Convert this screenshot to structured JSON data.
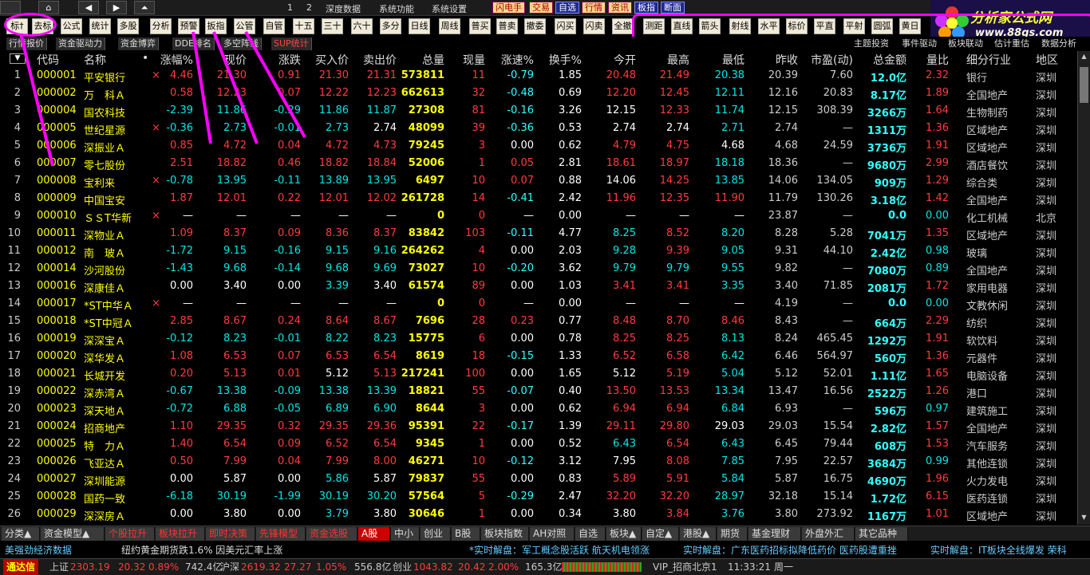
{
  "topbar": {
    "nums": [
      "1",
      "2"
    ],
    "menus": [
      "深度数据",
      "系统功能",
      "系统设置"
    ],
    "buttons": [
      "闪电手",
      "交易",
      "自选",
      "行情",
      "资讯",
      "板指",
      "断面"
    ]
  },
  "logo": {
    "title": "分析家公式网",
    "url": "www.88gs.com"
  },
  "toolbar": {
    "items": [
      "标†",
      "去标",
      "公式",
      "统计",
      "多股",
      "分析",
      "预警",
      "扳指",
      "公管",
      "自管",
      "十五",
      "三十",
      "六十",
      "多分",
      "日线",
      "周线",
      "普买",
      "普卖",
      "撤委",
      "闪买",
      "闪卖",
      "全撤",
      "测距",
      "直线",
      "箭头",
      "射线",
      "水平",
      "标价",
      "平直",
      "平射",
      "圆弧",
      "黄日"
    ]
  },
  "tabs2": {
    "left": [
      "行情报价",
      "资金驱动力",
      "资金博弈",
      "DDE排名",
      "多空阵线",
      "SUP统计"
    ],
    "right": [
      "主题投资",
      "事件驱动",
      "板块联动",
      "估计重估",
      "数据分析"
    ]
  },
  "columns": [
    "代码",
    "名称",
    "•",
    "涨幅%",
    "现价",
    "涨跌",
    "买入价",
    "卖出价",
    "总量",
    "现量",
    "涨速%",
    "换手%",
    "今开",
    "最高",
    "最低",
    "昨收",
    "市盈(动)",
    "总金额",
    "量比",
    "细分行业",
    "地区"
  ],
  "rows": [
    [
      "1",
      "000001",
      "平安银行",
      "×",
      "4.46",
      "21.30",
      "0.91",
      "21.30",
      "21.31",
      "573811",
      "11",
      "-0.79",
      "1.85",
      "20.48",
      "21.49",
      "20.38",
      "20.39",
      "7.60",
      "12.0亿",
      "2.32",
      "银行",
      "深圳"
    ],
    [
      "2",
      "000002",
      "万　科Ａ",
      "",
      "0.58",
      "12.23",
      "0.07",
      "12.22",
      "12.23",
      "662613",
      "32",
      "-0.48",
      "0.69",
      "12.20",
      "12.45",
      "12.11",
      "12.16",
      "20.83",
      "8.17亿",
      "1.89",
      "全国地产",
      "深圳"
    ],
    [
      "3",
      "000004",
      "国农科技",
      "",
      "-2.39",
      "11.86",
      "-0.29",
      "11.86",
      "11.87",
      "27308",
      "81",
      "-0.16",
      "3.26",
      "12.15",
      "12.33",
      "11.74",
      "12.15",
      "308.39",
      "3266万",
      "1.64",
      "生物制药",
      "深圳"
    ],
    [
      "4",
      "000005",
      "世纪星源",
      "×",
      "-0.36",
      "2.73",
      "-0.01",
      "2.73",
      "2.74",
      "48099",
      "39",
      "-0.36",
      "0.53",
      "2.74",
      "2.74",
      "2.71",
      "2.74",
      "—",
      "1311万",
      "1.36",
      "区域地产",
      "深圳"
    ],
    [
      "5",
      "000006",
      "深振业Ａ",
      "",
      "0.85",
      "4.72",
      "0.04",
      "4.72",
      "4.73",
      "79245",
      "3",
      "0.00",
      "0.62",
      "4.79",
      "4.75",
      "4.68",
      "4.68",
      "24.59",
      "3736万",
      "1.91",
      "区域地产",
      "深圳"
    ],
    [
      "6",
      "000007",
      "零七股份",
      "",
      "2.51",
      "18.82",
      "0.46",
      "18.82",
      "18.84",
      "52006",
      "1",
      "0.05",
      "2.81",
      "18.61",
      "18.97",
      "18.18",
      "18.36",
      "—",
      "9680万",
      "2.99",
      "酒店餐饮",
      "深圳"
    ],
    [
      "7",
      "000008",
      "宝利来",
      "×",
      "-0.78",
      "13.95",
      "-0.11",
      "13.89",
      "13.95",
      "6497",
      "10",
      "0.07",
      "0.88",
      "14.06",
      "14.25",
      "13.85",
      "14.06",
      "134.05",
      "909万",
      "1.29",
      "综合类",
      "深圳"
    ],
    [
      "8",
      "000009",
      "中国宝安",
      "",
      "1.87",
      "12.01",
      "0.22",
      "12.01",
      "12.02",
      "261728",
      "14",
      "-0.41",
      "2.42",
      "11.96",
      "12.35",
      "11.90",
      "11.79",
      "130.26",
      "3.18亿",
      "1.42",
      "全国地产",
      "深圳"
    ],
    [
      "9",
      "000010",
      "ＳＳT华新",
      "×",
      "—",
      "—",
      "—",
      "—",
      "—",
      "0",
      "0",
      "—",
      "0.00",
      "—",
      "—",
      "—",
      "23.87",
      "—",
      "0.0",
      "0.00",
      "化工机械",
      "北京"
    ],
    [
      "10",
      "000011",
      "深物业Ａ",
      "",
      "1.09",
      "8.37",
      "0.09",
      "8.36",
      "8.37",
      "83842",
      "103",
      "-0.11",
      "4.77",
      "8.25",
      "8.52",
      "8.20",
      "8.28",
      "5.28",
      "7041万",
      "1.35",
      "区域地产",
      "深圳"
    ],
    [
      "11",
      "000012",
      "南　玻Ａ",
      "",
      "-1.72",
      "9.15",
      "-0.16",
      "9.15",
      "9.16",
      "264262",
      "4",
      "0.00",
      "2.03",
      "9.28",
      "9.39",
      "9.05",
      "9.31",
      "44.10",
      "2.42亿",
      "0.98",
      "玻璃",
      "深圳"
    ],
    [
      "12",
      "000014",
      "沙河股份",
      "",
      "-1.43",
      "9.68",
      "-0.14",
      "9.68",
      "9.69",
      "73027",
      "10",
      "-0.20",
      "3.62",
      "9.79",
      "9.79",
      "9.55",
      "9.82",
      "—",
      "7080万",
      "0.89",
      "全国地产",
      "深圳"
    ],
    [
      "13",
      "000016",
      "深康佳Ａ",
      "",
      "0.00",
      "3.40",
      "0.00",
      "3.39",
      "3.40",
      "61574",
      "89",
      "0.00",
      "1.03",
      "3.41",
      "3.41",
      "3.35",
      "3.40",
      "71.85",
      "2081万",
      "1.72",
      "家用电器",
      "深圳"
    ],
    [
      "14",
      "000017",
      "*ST中华Ａ",
      "×",
      "—",
      "—",
      "—",
      "—",
      "—",
      "0",
      "0",
      "—",
      "0.00",
      "—",
      "—",
      "—",
      "4.19",
      "—",
      "0.0",
      "0.00",
      "文教休闲",
      "深圳"
    ],
    [
      "15",
      "000018",
      "*ST中冠Ａ",
      "",
      "2.85",
      "8.67",
      "0.24",
      "8.64",
      "8.67",
      "7696",
      "28",
      "0.23",
      "0.77",
      "8.48",
      "8.70",
      "8.46",
      "8.43",
      "—",
      "664万",
      "2.29",
      "纺织",
      "深圳"
    ],
    [
      "16",
      "000019",
      "深深宝Ａ",
      "",
      "-0.12",
      "8.23",
      "-0.01",
      "8.22",
      "8.23",
      "15775",
      "6",
      "0.00",
      "0.78",
      "8.25",
      "8.25",
      "8.13",
      "8.24",
      "465.45",
      "1292万",
      "1.91",
      "软饮料",
      "深圳"
    ],
    [
      "17",
      "000020",
      "深华发Ａ",
      "",
      "1.08",
      "6.53",
      "0.07",
      "6.53",
      "6.54",
      "8619",
      "18",
      "-0.15",
      "1.33",
      "6.52",
      "6.58",
      "6.42",
      "6.46",
      "564.97",
      "560万",
      "1.36",
      "元器件",
      "深圳"
    ],
    [
      "18",
      "000021",
      "长城开发",
      "",
      "0.20",
      "5.13",
      "0.01",
      "5.12",
      "5.13",
      "217241",
      "100",
      "0.00",
      "1.65",
      "5.12",
      "5.19",
      "5.04",
      "5.12",
      "52.01",
      "1.11亿",
      "1.65",
      "电脑设备",
      "深圳"
    ],
    [
      "19",
      "000022",
      "深赤湾Ａ",
      "",
      "-0.67",
      "13.38",
      "-0.09",
      "13.38",
      "13.39",
      "18821",
      "55",
      "-0.07",
      "0.40",
      "13.50",
      "13.53",
      "13.34",
      "13.47",
      "16.56",
      "2522万",
      "1.26",
      "港口",
      "深圳"
    ],
    [
      "20",
      "000023",
      "深天地Ａ",
      "",
      "-0.72",
      "6.88",
      "-0.05",
      "6.89",
      "6.90",
      "8644",
      "3",
      "0.00",
      "0.62",
      "6.94",
      "6.94",
      "6.84",
      "6.93",
      "—",
      "596万",
      "0.97",
      "建筑施工",
      "深圳"
    ],
    [
      "21",
      "000024",
      "招商地产",
      "",
      "1.10",
      "29.35",
      "0.32",
      "29.35",
      "29.36",
      "95391",
      "22",
      "-0.17",
      "1.39",
      "29.11",
      "29.80",
      "29.03",
      "29.03",
      "15.54",
      "2.82亿",
      "1.57",
      "全国地产",
      "深圳"
    ],
    [
      "22",
      "000025",
      "特　力Ａ",
      "",
      "1.40",
      "6.54",
      "0.09",
      "6.52",
      "6.54",
      "9345",
      "1",
      "0.00",
      "0.52",
      "6.43",
      "6.54",
      "6.43",
      "6.45",
      "79.44",
      "608万",
      "1.53",
      "汽车服务",
      "深圳"
    ],
    [
      "23",
      "000026",
      "飞亚达Ａ",
      "",
      "0.50",
      "7.99",
      "0.04",
      "7.99",
      "8.00",
      "46271",
      "10",
      "-0.12",
      "3.12",
      "7.95",
      "8.08",
      "7.85",
      "7.95",
      "22.57",
      "3684万",
      "0.99",
      "其他连锁",
      "深圳"
    ],
    [
      "24",
      "000027",
      "深圳能源",
      "",
      "0.00",
      "5.87",
      "0.00",
      "5.86",
      "5.87",
      "79837",
      "55",
      "0.00",
      "0.83",
      "5.89",
      "5.91",
      "5.84",
      "5.87",
      "16.75",
      "4690万",
      "1.96",
      "火力发电",
      "深圳"
    ],
    [
      "25",
      "000028",
      "国药一致",
      "",
      "-6.18",
      "30.19",
      "-1.99",
      "30.19",
      "30.20",
      "57564",
      "5",
      "-0.29",
      "2.47",
      "32.20",
      "32.20",
      "28.97",
      "32.18",
      "15.14",
      "1.72亿",
      "6.15",
      "医药连锁",
      "深圳"
    ],
    [
      "26",
      "000029",
      "深深房Ａ",
      "",
      "0.00",
      "3.80",
      "0.00",
      "3.79",
      "3.80",
      "30646",
      "1",
      "0.00",
      "0.34",
      "3.80",
      "3.84",
      "3.76",
      "3.80",
      "273.92",
      "1167万",
      "1.01",
      "区域地产",
      "深圳"
    ]
  ],
  "bottabs": [
    "分类▲",
    "资金模型▲",
    "个股拉升",
    "板块拉升",
    "即时决策",
    "先锋模型",
    "资金选股",
    "A股",
    "中小",
    "创业",
    "B股",
    "板块指数",
    "AH对照",
    "自选",
    "板块▲",
    "自定▲",
    "港股▲",
    "期货▲",
    "基金理财▲",
    "外盘外汇▲",
    "其它品种▲"
  ],
  "ticker": [
    "美强劲经济数据",
    "纽约黄金期货跌1.6% 因美元汇率上涨",
    "*实时解盘：军工概念股活跃 航天机电领涨",
    "实时解盘：广东医药招标拟降低药价 医药股遭重挫",
    "实时解盘：IT板块全线爆发 荣科"
  ],
  "status": {
    "brand": "通达信",
    "sh_label": "上证",
    "sh_val": "2303.19",
    "sh_chg": "20.32",
    "sh_pct": "0.89%",
    "sh_amt": "742.4亿",
    "sz_label": "沪深",
    "sz_val": "2619.32",
    "sz_chg": "27.27",
    "sz_pct": "1.05%",
    "sz_amt": "556.8亿",
    "cy_label": "创业",
    "cy_val": "1043.82",
    "cy_chg": "20.42",
    "cy_pct": "2.00%",
    "cy_amt": "165.3亿",
    "vip": "VIP_招商北京1",
    "time": "11:33:21",
    "day": "周一"
  }
}
